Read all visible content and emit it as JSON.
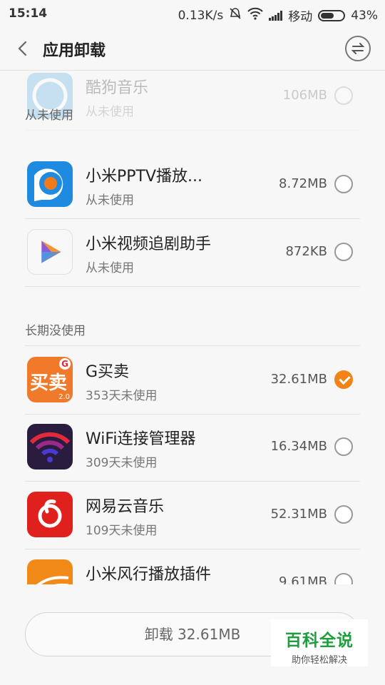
{
  "status_bar": {
    "time": "15:14",
    "net_speed": "0.13K/s",
    "carrier": "移动",
    "battery": "43%"
  },
  "header": {
    "title": "应用卸载"
  },
  "sections": {
    "unused": "从未使用",
    "long_unused": "长期没使用"
  },
  "apps": [
    {
      "name": "酷狗音乐",
      "sub": "从未使用",
      "size": "106MB",
      "checked": false
    },
    {
      "name": "小米PPTV播放...",
      "sub": "从未使用",
      "size": "8.72MB",
      "checked": false
    },
    {
      "name": "小米视频追剧助手",
      "sub": "从未使用",
      "size": "872KB",
      "checked": false
    },
    {
      "name": "G买卖",
      "sub": "353天未使用",
      "size": "32.61MB",
      "checked": true
    },
    {
      "name": "WiFi连接管理器",
      "sub": "309天未使用",
      "size": "16.34MB",
      "checked": false
    },
    {
      "name": "网易云音乐",
      "sub": "109天未使用",
      "size": "52.31MB",
      "checked": false
    },
    {
      "name": "小米风行播放插件",
      "sub": "",
      "size": "9.61MB",
      "checked": false
    }
  ],
  "icon_text": {
    "gmm_main": "买卖",
    "gmm_g": "G",
    "gmm_ver": "2.0"
  },
  "bottom": {
    "uninstall_label": "卸载 32.61MB"
  },
  "watermark": {
    "title": "百科全说",
    "subtitle": "助你轻松解决"
  },
  "colors": {
    "accent": "#f08418",
    "watermark_green": "#1e9e3e"
  }
}
